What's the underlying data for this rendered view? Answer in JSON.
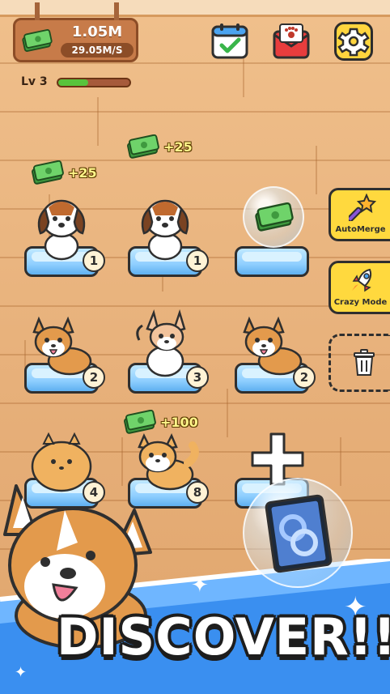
{
  "hud": {
    "money_total": "1.05M",
    "money_rate": "29.05M/S",
    "level_label": "Lv 3",
    "level_progress": 0.42
  },
  "buttons": {
    "calendar": "calendar-icon",
    "mail": "paw-mail-icon",
    "settings": "gear-icon",
    "auto_merge_label": "AutoMerge",
    "crazy_mode_label": "Crazy Mode"
  },
  "grid": [
    {
      "breed": "beagle",
      "level": "1",
      "cash_pop": "+25"
    },
    {
      "breed": "beagle",
      "level": "1",
      "cash_pop": "+25"
    },
    {
      "breed": "cash-bubble",
      "level": "",
      "cash_pop": ""
    },
    {
      "breed": "corgi",
      "level": "2",
      "cash_pop": ""
    },
    {
      "breed": "chihuahua",
      "level": "3",
      "cash_pop": ""
    },
    {
      "breed": "corgi",
      "level": "2",
      "cash_pop": ""
    },
    {
      "breed": "pomeranian",
      "level": "4",
      "cash_pop": ""
    },
    {
      "breed": "shiba",
      "level": "8",
      "cash_pop": "+100"
    },
    {
      "breed": "empty-plus",
      "level": "",
      "cash_pop": ""
    }
  ],
  "banner": {
    "headline": "DISCOVER!!"
  },
  "colors": {
    "floor": "#e9b177",
    "accent_yellow": "#ffd93e",
    "cushion_blue": "#8fcfff",
    "banner_blue": "#3a8ff0"
  }
}
